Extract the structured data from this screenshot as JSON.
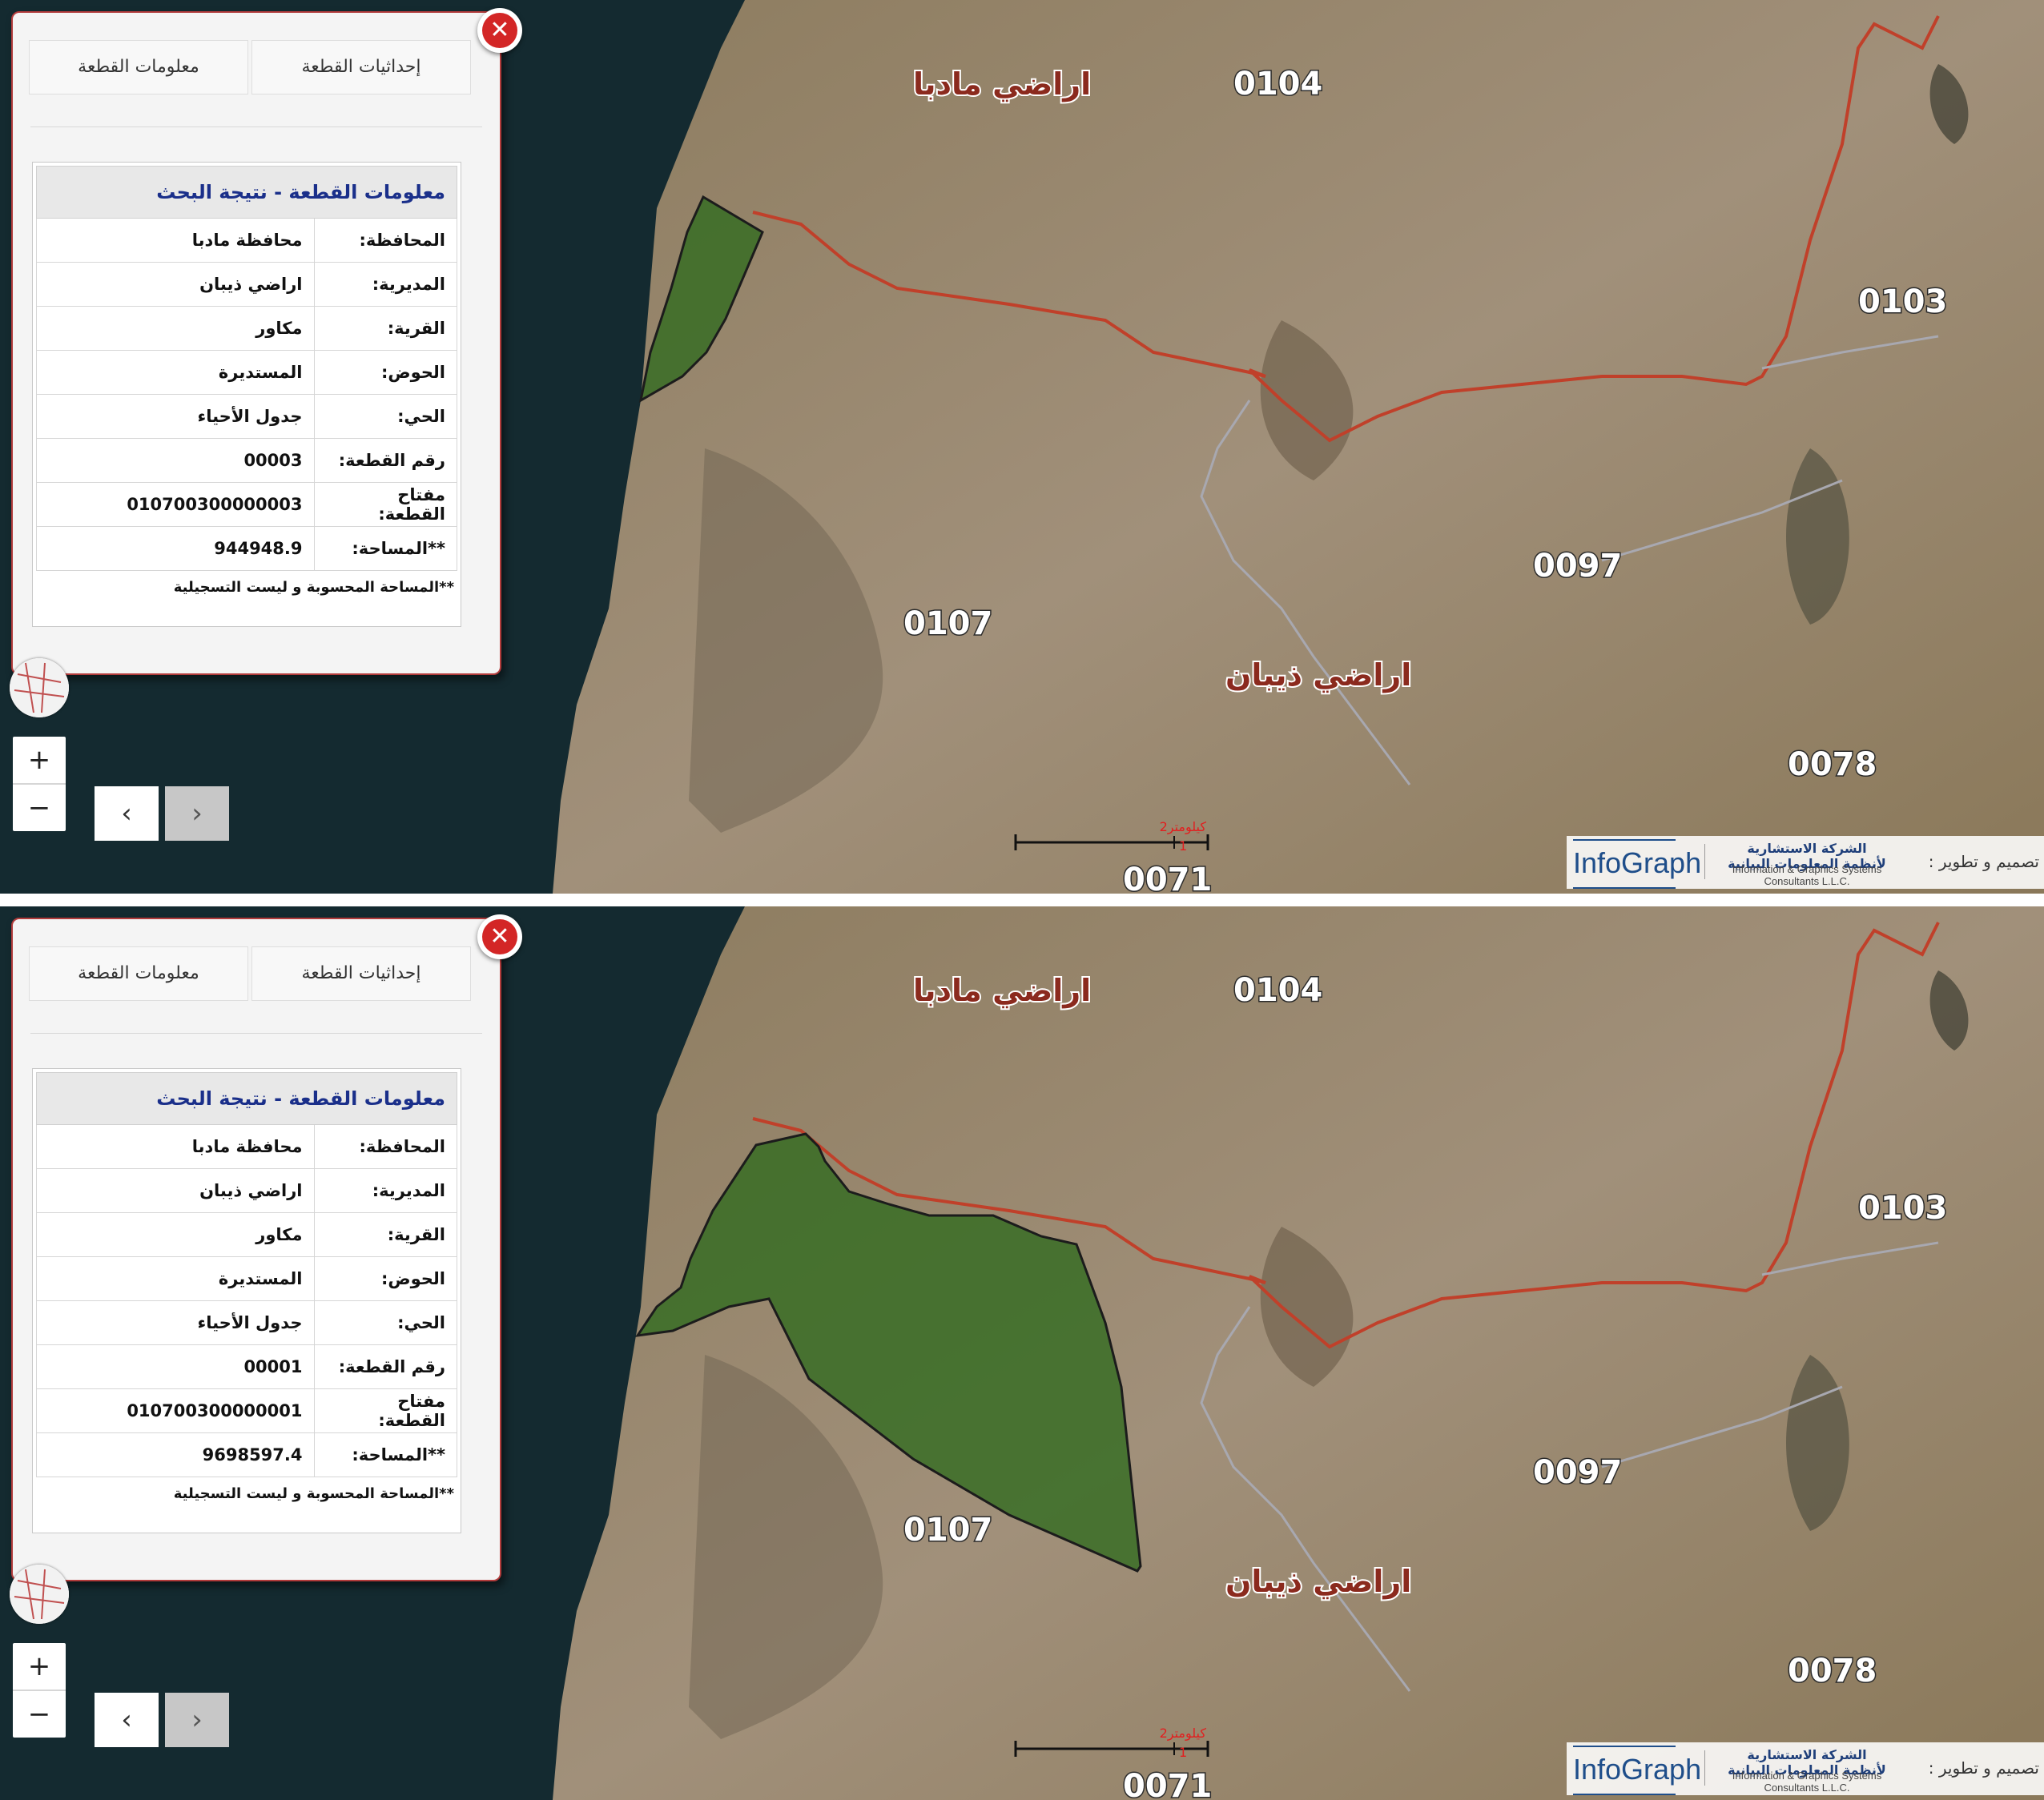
{
  "panes": [
    {
      "tabs": [
        "معلومات القطعة",
        "إحداثيات القطعة"
      ],
      "table": {
        "header": "معلومات القطعة - نتيجة البحث",
        "rows": [
          {
            "label": "المحافظة:",
            "value": "محافظة مادبا"
          },
          {
            "label": "المديرية:",
            "value": "اراضي ذيبان"
          },
          {
            "label": "القرية:",
            "value": "مكاور"
          },
          {
            "label": "الحوض:",
            "value": "المستديرة"
          },
          {
            "label": "الحي:",
            "value": "جدول الأحياء"
          },
          {
            "label": "رقم القطعة:",
            "value": "00003"
          },
          {
            "label": "مفتاح القطعة:",
            "value": "010700300000003"
          },
          {
            "label": "**المساحة:",
            "value": "944948.9"
          }
        ],
        "footnote": "**المساحة المحسوبة و ليست التسجيلية"
      },
      "map": {
        "labels": [
          "0104",
          "اراضي مادبا",
          "0103",
          "0097",
          "0107",
          "اراضي ذيبان",
          "0078",
          "0071"
        ],
        "scale": {
          "label": "2كيلومتر",
          "sub": "1"
        },
        "parcel_color": "#2f6a1e"
      }
    },
    {
      "tabs": [
        "معلومات القطعة",
        "إحداثيات القطعة"
      ],
      "table": {
        "header": "معلومات القطعة - نتيجة البحث",
        "rows": [
          {
            "label": "المحافظة:",
            "value": "محافظة مادبا"
          },
          {
            "label": "المديرية:",
            "value": "اراضي ذيبان"
          },
          {
            "label": "القرية:",
            "value": "مكاور"
          },
          {
            "label": "الحوض:",
            "value": "المستديرة"
          },
          {
            "label": "الحي:",
            "value": "جدول الأحياء"
          },
          {
            "label": "رقم القطعة:",
            "value": "00001"
          },
          {
            "label": "مفتاح القطعة:",
            "value": "010700300000001"
          },
          {
            "label": "**المساحة:",
            "value": "9698597.4"
          }
        ],
        "footnote": "**المساحة المحسوبة و ليست التسجيلية"
      },
      "map": {
        "labels": [
          "0104",
          "اراضي مادبا",
          "0103",
          "0097",
          "0107",
          "اراضي ذيبان",
          "0078",
          "0071"
        ],
        "scale": {
          "label": "2كيلومتر",
          "sub": "1"
        },
        "parcel_color": "#2f6a1e"
      }
    }
  ],
  "controls": {
    "zoom_in": "+",
    "zoom_out": "−",
    "prev": "‹",
    "next": "›",
    "close": "✕"
  },
  "credits": {
    "brand": "InfoGraph",
    "company_ar": "الشركة الاستشارية لأنظمة المعلومات البيانية",
    "company_en": "Information & Graphics Systems Consultants L.L.C.",
    "design": "تصميم و تطوير :"
  },
  "colors": {
    "boundary": "#c0402a",
    "header_text": "#1a2f8a",
    "close": "#d32626",
    "water": "#142a30",
    "land": "#9a8a6a"
  }
}
